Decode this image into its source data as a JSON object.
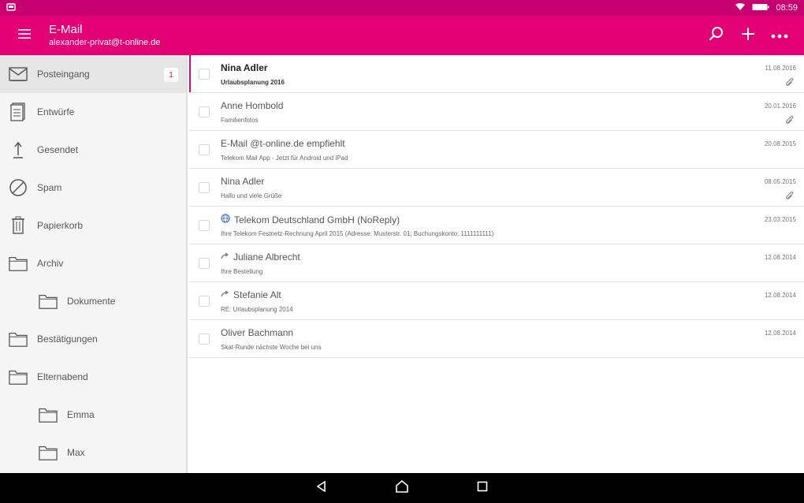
{
  "status_bar": {
    "time": "08:59"
  },
  "app_bar": {
    "title": "E-Mail",
    "subtitle": "alexander-privat@t-online.de"
  },
  "colors": {
    "brand": "#e20074",
    "status_bar": "#c70070"
  },
  "folders": [
    {
      "label": "Posteingang",
      "icon": "inbox-icon",
      "badge": "1"
    },
    {
      "label": "Entwürfe",
      "icon": "drafts-icon"
    },
    {
      "label": "Gesendet",
      "icon": "sent-icon"
    },
    {
      "label": "Spam",
      "icon": "spam-icon"
    },
    {
      "label": "Papierkorb",
      "icon": "trash-icon"
    },
    {
      "label": "Archiv",
      "icon": "folder-icon"
    },
    {
      "label": "Dokumente",
      "icon": "folder-icon"
    },
    {
      "label": "Bestätigungen",
      "icon": "folder-icon"
    },
    {
      "label": "Elternabend",
      "icon": "folder-icon"
    },
    {
      "label": "Emma",
      "icon": "folder-icon"
    },
    {
      "label": "Max",
      "icon": "folder-icon"
    }
  ],
  "messages": [
    {
      "sender": "Nina Adler",
      "subject": "Urlaubsplanung 2016",
      "date": "11.08.2016",
      "attachment": true,
      "unread": true
    },
    {
      "sender": "Anne Hombold",
      "subject": "Familienfotos",
      "date": "20.01.2016",
      "attachment": true
    },
    {
      "sender": "E-Mail @t-online.de empfiehlt",
      "subject": "Telekom Mail App - Jetzt für Android und iPad",
      "date": "20.08.2015"
    },
    {
      "sender": "Nina Adler",
      "subject": "Hallo und viele Grüße",
      "date": "08.05.2015",
      "attachment": true
    },
    {
      "sender": "Telekom Deutschland GmbH (NoReply)",
      "subject": "Ihre Telekom Festnetz-Rechnung April 2015 (Adresse: Musterstr. 01; Buchungskonto: 1111111111)",
      "date": "23.03.2015",
      "sender_icon": "globe-icon"
    },
    {
      "sender": "Juliane Albrecht",
      "subject": "Ihre Bestellung",
      "date": "12.08.2014",
      "sender_icon": "forward-icon"
    },
    {
      "sender": "Stefanie Alt",
      "subject": "RE: Urlaubsplanung 2014",
      "date": "12.08.2014",
      "sender_icon": "forward-icon"
    },
    {
      "sender": "Oliver Bachmann",
      "subject": "Skat-Runde nächste Woche bei uns",
      "date": "12.08.2014"
    }
  ]
}
